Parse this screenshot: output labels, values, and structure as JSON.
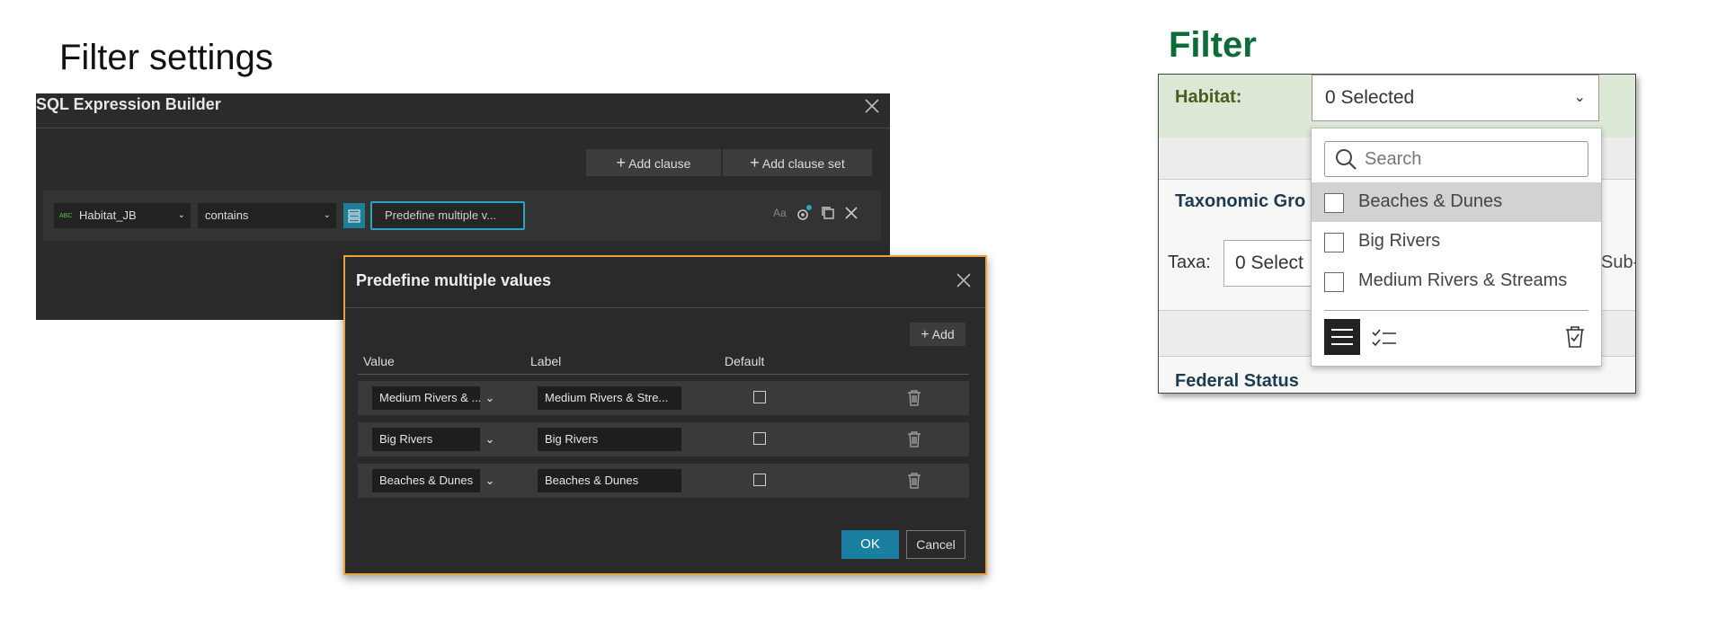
{
  "left_heading": "Filter settings",
  "sql_builder": {
    "title": "SQL Expression Builder",
    "add_clause": "Add clause",
    "add_clause_set": "Add clause set",
    "field": {
      "type_badge": "ABC",
      "value": "Habitat_JB"
    },
    "operator": "contains",
    "value_box": "Predefine multiple v...",
    "case_icon_text": "Aa"
  },
  "predefine_dialog": {
    "title": "Predefine multiple values",
    "add_label": "Add",
    "columns": {
      "value": "Value",
      "label": "Label",
      "default": "Default"
    },
    "rows": [
      {
        "value": "Medium Rivers & ...",
        "label": "Medium Rivers & Stre..."
      },
      {
        "value": "Big Rivers",
        "label": "Big Rivers"
      },
      {
        "value": "Beaches & Dunes",
        "label": "Beaches & Dunes"
      }
    ],
    "ok": "OK",
    "cancel": "Cancel"
  },
  "filter_widget": {
    "heading": "Filter",
    "habitat_label": "Habitat:",
    "habitat_value": "0 Selected",
    "taxonomic_heading": "Taxonomic Gro",
    "taxa_label": "Taxa:",
    "taxa_value": "0 Select",
    "sub_text": "Sub-",
    "federal_heading": "Federal Status",
    "dropdown": {
      "search_placeholder": "Search",
      "options": [
        "Beaches & Dunes",
        "Big Rivers",
        "Medium Rivers & Streams"
      ]
    }
  },
  "colors": {
    "filter_heading": "#0d6b38",
    "dialog_border": "#e8a33a",
    "accent_blue": "#1a7fa0"
  }
}
